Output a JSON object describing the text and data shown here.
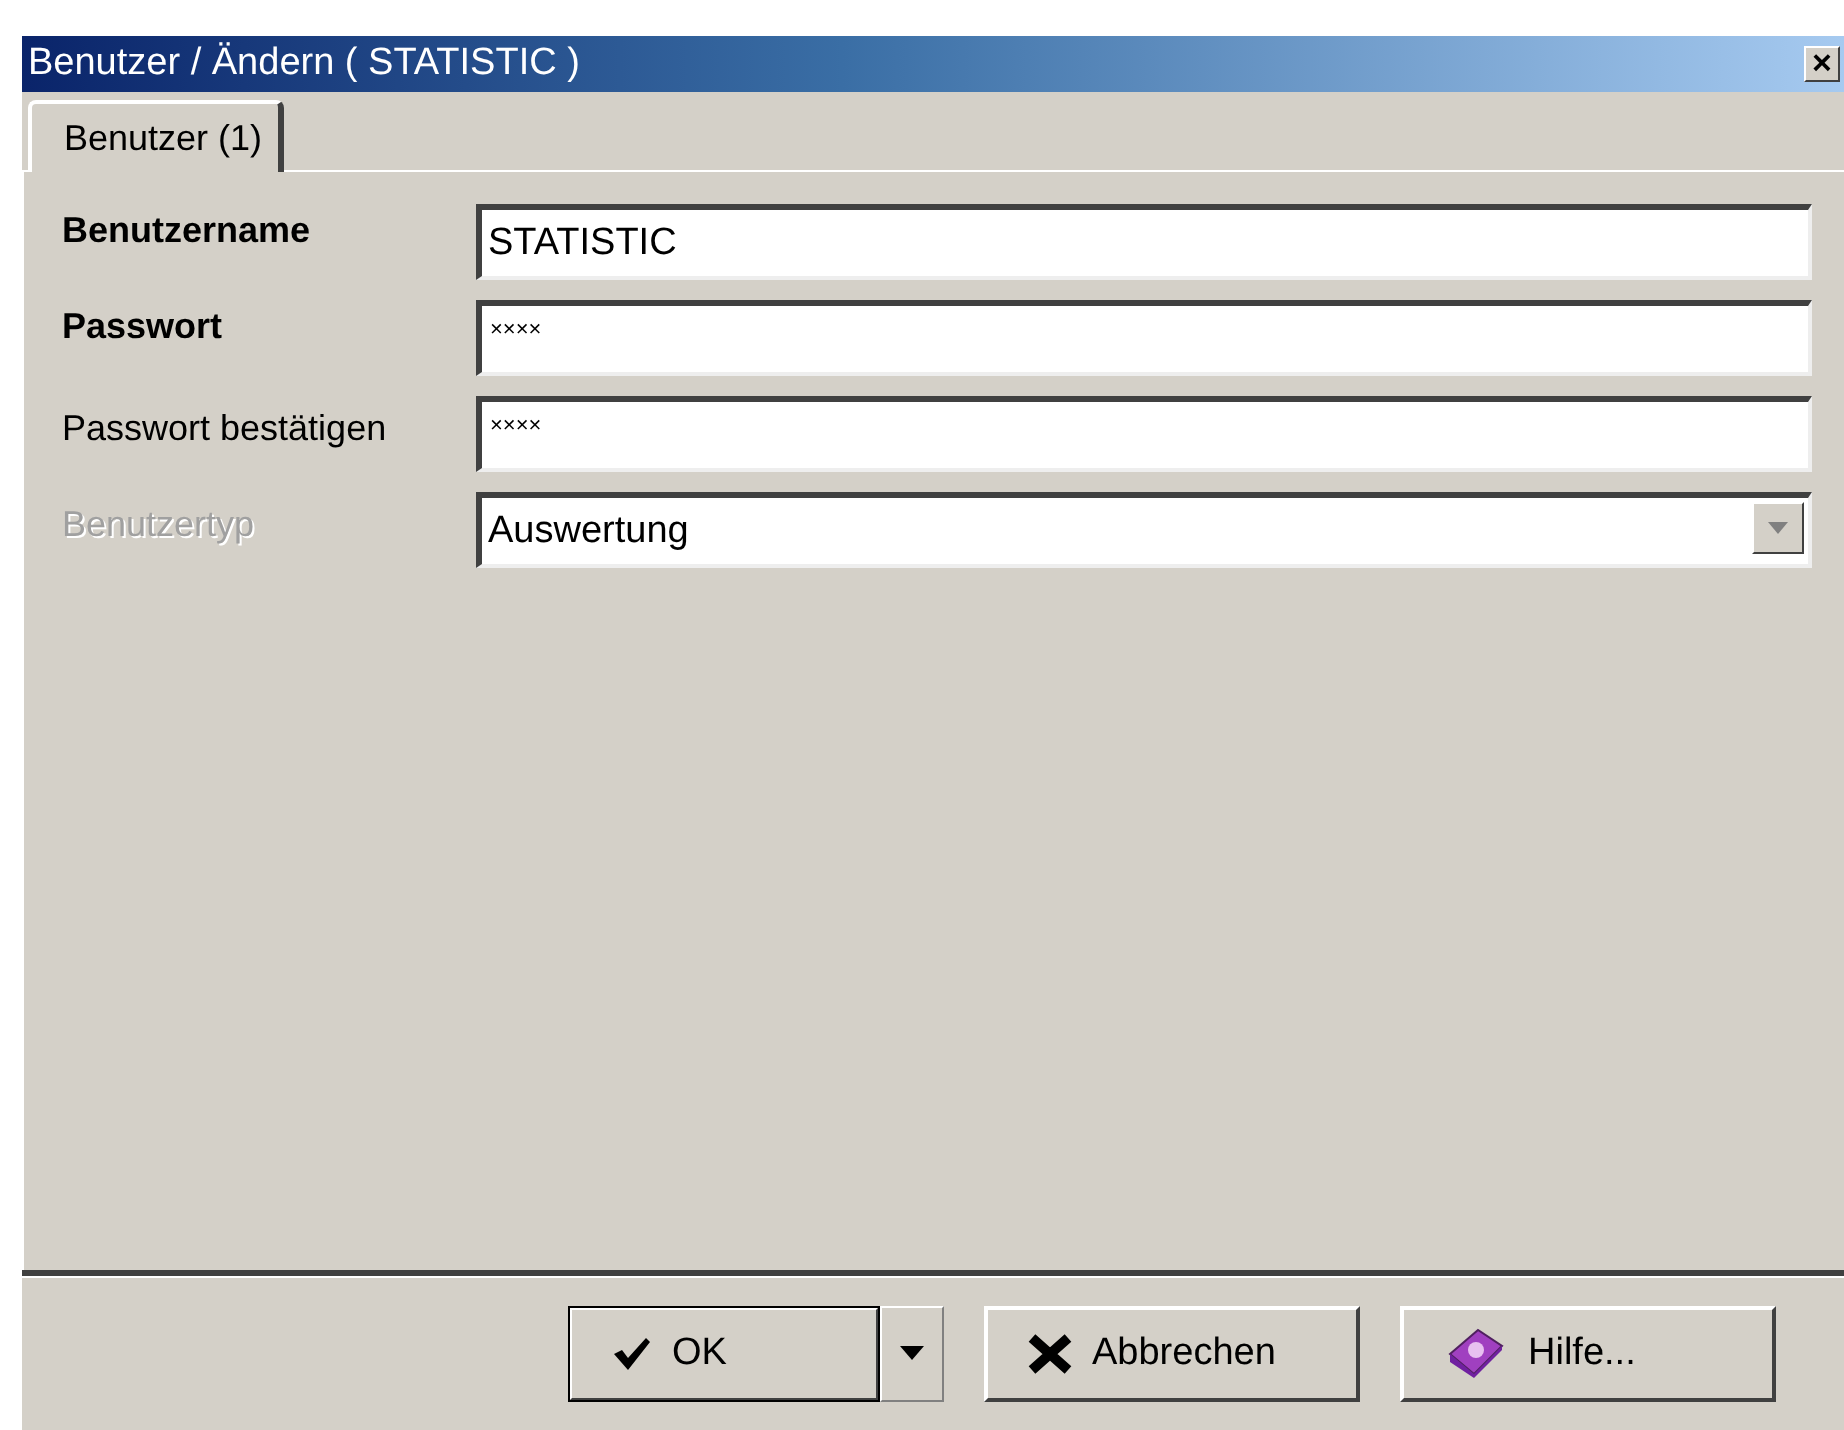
{
  "window": {
    "title": "Benutzer / Ändern ( STATISTIC )",
    "close": "×"
  },
  "tabs": [
    {
      "label": "Benutzer (1)",
      "selected": true
    }
  ],
  "fields": [
    {
      "kind": "text",
      "label": "Benutzername",
      "bold": true,
      "disabled": false,
      "value": "STATISTIC"
    },
    {
      "kind": "password",
      "label": "Passwort",
      "bold": true,
      "disabled": false,
      "value": "××××"
    },
    {
      "kind": "password",
      "label": "Passwort bestätigen",
      "bold": false,
      "disabled": false,
      "value": "××××"
    },
    {
      "kind": "select",
      "label": "Benutzertyp",
      "bold": false,
      "disabled": true,
      "value": "Auswertung"
    }
  ],
  "buttons": [
    {
      "kind": "ok",
      "label": "OK",
      "default": true
    },
    {
      "kind": "cancel",
      "label": "Abbrechen",
      "default": false
    },
    {
      "kind": "help",
      "label": "Hilfe...",
      "default": false
    }
  ]
}
